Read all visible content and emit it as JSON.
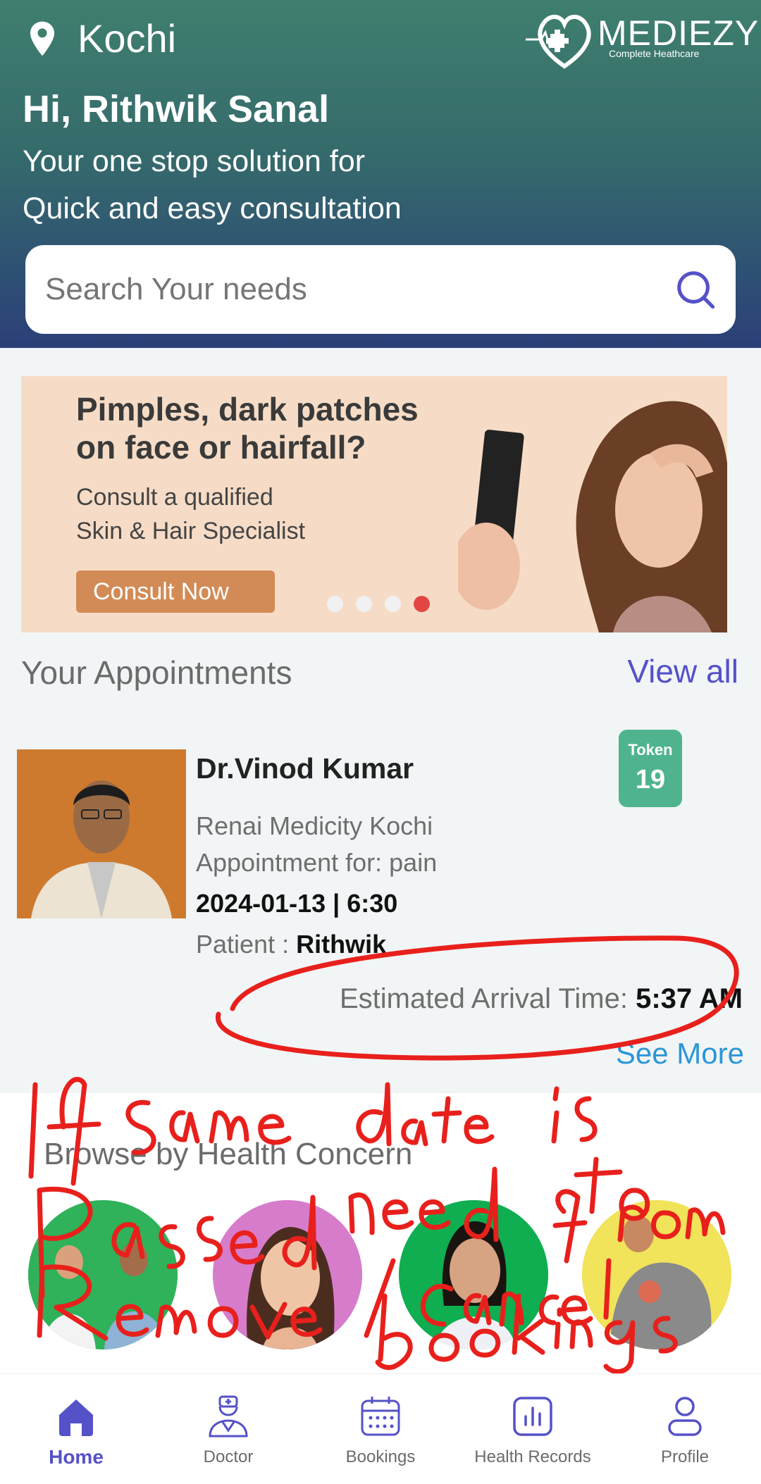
{
  "header": {
    "location": "Kochi",
    "greeting": "Hi, Rithwik Sanal",
    "tagline_1": "Your one stop solution for",
    "tagline_2": "Quick and easy consultation",
    "logo_word": "MEDIEZY",
    "logo_sub": "Complete Heathcare"
  },
  "search": {
    "placeholder": "Search Your needs"
  },
  "banner": {
    "title_1": "Pimples, dark patches",
    "title_2": "on face or hairfall?",
    "sub_1": "Consult a qualified",
    "sub_2": "Skin & Hair Specialist",
    "button": "Consult Now",
    "slide_count": 4,
    "active_slide": 4
  },
  "appointments": {
    "title": "Your Appointments",
    "view_all": "View all",
    "items": [
      {
        "doctor": "Dr.Vinod Kumar",
        "hospital": "Renai Medicity Kochi",
        "reason": "Appointment for: pain",
        "datetime": "2024-01-13 | 6:30",
        "patient_label": "Patient : ",
        "patient": "Rithwik",
        "token_label": "Token",
        "token": "19",
        "eta_label": "Estimated Arrival Time: ",
        "eta": "5:37 AM"
      }
    ],
    "see_more": "See More"
  },
  "health_concern": {
    "title": "Browse by Health Concern"
  },
  "annotation": "If same date is passed need to Remove / cancel from bookings",
  "nav": [
    {
      "label": "Home",
      "icon": "home-icon",
      "active": true
    },
    {
      "label": "Doctor",
      "icon": "doctor-icon",
      "active": false
    },
    {
      "label": "Bookings",
      "icon": "calendar-icon",
      "active": false
    },
    {
      "label": "Health Records",
      "icon": "chart-icon",
      "active": false
    },
    {
      "label": "Profile",
      "icon": "profile-icon",
      "active": false
    }
  ],
  "colors": {
    "accent": "#5551c8",
    "token": "#4fb48e",
    "link": "#2c96d8",
    "annotation": "#e8201c",
    "banner_button": "#d28b56"
  }
}
